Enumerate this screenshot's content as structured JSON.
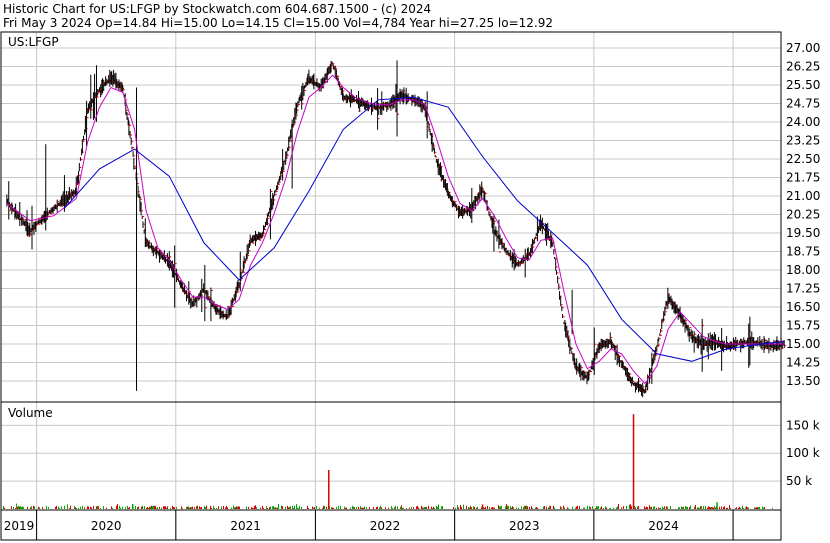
{
  "header": {
    "line1": "Historic Chart for US:LFGP by Stockwatch.com 604.687.1500 - (c) 2024",
    "line2": "Fri May  3 2024   Op=14.84  Hi=15.00  Lo=14.15  Cl=15.00  Vol=4,784  Year hi=27.25  lo=12.92"
  },
  "chart_data": [
    {
      "type": "line",
      "title": "US:LFGP",
      "yticks": [
        "27.00",
        "26.25",
        "25.50",
        "24.75",
        "24.00",
        "23.25",
        "22.50",
        "21.75",
        "21.00",
        "20.25",
        "19.50",
        "18.75",
        "18.00",
        "17.25",
        "16.50",
        "15.75",
        "15.00",
        "14.25",
        "13.50"
      ],
      "ylim": [
        12.92,
        27.5
      ],
      "x_range": [
        "2018-10-01",
        "2024-05-03"
      ],
      "x_year_labels": [
        "2019",
        "2020",
        "2021",
        "2022",
        "2023",
        "2024"
      ],
      "grid": true,
      "series": [
        {
          "color": "#000000",
          "x": [
            "2018-10",
            "2018-12",
            "2019-02",
            "2019-04",
            "2019-05",
            "2019-06",
            "2019-07",
            "2019-08",
            "2019-09",
            "2019-10",
            "2019-11",
            "2019-12",
            "2020-01",
            "2020-02",
            "2020-03",
            "2020-04",
            "2020-05",
            "2020-06",
            "2020-07",
            "2020-08",
            "2020-09",
            "2020-10",
            "2020-11",
            "2020-12",
            "2021-01",
            "2021-02",
            "2021-03",
            "2021-04",
            "2021-05",
            "2021-06",
            "2021-07",
            "2021-08",
            "2021-09",
            "2021-10",
            "2021-11",
            "2021-12",
            "2022-01",
            "2022-02",
            "2022-03",
            "2022-04",
            "2022-05",
            "2022-06",
            "2022-07",
            "2022-08",
            "2022-09",
            "2022-10",
            "2022-11",
            "2022-12",
            "2023-01",
            "2023-02",
            "2023-03",
            "2023-04",
            "2023-05",
            "2023-06",
            "2023-07",
            "2023-08",
            "2023-09",
            "2023-10",
            "2023-11",
            "2023-12",
            "2024-01",
            "2024-02",
            "2024-03",
            "2024-04",
            "2024-05"
          ],
          "values": [
            20.8,
            19.6,
            20.5,
            21.2,
            24.5,
            25.3,
            25.8,
            25.4,
            22.3,
            19.1,
            18.7,
            18.3,
            17.4,
            16.6,
            17.2,
            16.4,
            16.1,
            17.4,
            19.2,
            19.4,
            21.0,
            22.5,
            24.7,
            25.8,
            25.4,
            26.4,
            25.0,
            24.9,
            24.7,
            24.6,
            24.7,
            25.1,
            24.9,
            24.6,
            22.4,
            21.1,
            20.3,
            20.5,
            21.3,
            19.6,
            18.8,
            18.2,
            18.6,
            19.9,
            19.1,
            15.8,
            14.1,
            13.6,
            14.9,
            15.1,
            14.2,
            13.4,
            13.1,
            14.8,
            16.9,
            16.2,
            15.3,
            15.0,
            15.1,
            14.9,
            15.0,
            15.1,
            15.0,
            14.9,
            15.0
          ]
        },
        {
          "color": "#cc00cc",
          "x": [
            "2018-10",
            "2018-12",
            "2019-02",
            "2019-04",
            "2019-05",
            "2019-06",
            "2019-07",
            "2019-08",
            "2019-09",
            "2019-10",
            "2019-11",
            "2019-12",
            "2020-01",
            "2020-02",
            "2020-03",
            "2020-04",
            "2020-05",
            "2020-06",
            "2020-07",
            "2020-08",
            "2020-09",
            "2020-10",
            "2020-11",
            "2020-12",
            "2021-01",
            "2021-02",
            "2021-03",
            "2021-04",
            "2021-05",
            "2021-06",
            "2021-07",
            "2021-08",
            "2021-09",
            "2021-10",
            "2021-11",
            "2021-12",
            "2022-01",
            "2022-02",
            "2022-03",
            "2022-04",
            "2022-05",
            "2022-06",
            "2022-07",
            "2022-08",
            "2022-09",
            "2022-10",
            "2022-11",
            "2022-12",
            "2023-01",
            "2023-02",
            "2023-03",
            "2023-04",
            "2023-05",
            "2023-06",
            "2023-07",
            "2023-08",
            "2023-09",
            "2023-10",
            "2023-11",
            "2023-12",
            "2024-01",
            "2024-02",
            "2024-03",
            "2024-04",
            "2024-05"
          ],
          "values": [
            20.7,
            20.0,
            20.2,
            20.9,
            23.2,
            24.6,
            25.4,
            25.2,
            23.7,
            20.4,
            18.9,
            18.4,
            17.6,
            16.9,
            16.9,
            16.6,
            16.4,
            16.8,
            18.2,
            19.1,
            20.3,
            21.7,
            23.6,
            25.0,
            25.4,
            25.9,
            25.4,
            25.0,
            24.8,
            24.7,
            24.7,
            24.9,
            24.9,
            24.7,
            23.3,
            21.8,
            20.7,
            20.4,
            20.9,
            20.2,
            19.3,
            18.5,
            18.4,
            19.2,
            19.3,
            17.1,
            15.0,
            14.0,
            14.3,
            14.8,
            14.6,
            13.9,
            13.4,
            14.1,
            15.6,
            16.3,
            15.8,
            15.3,
            15.1,
            15.0,
            15.0,
            15.0,
            15.0,
            15.0,
            15.0
          ]
        },
        {
          "color": "#0000cc",
          "x": [
            "2019-03",
            "2019-06",
            "2019-09",
            "2019-12",
            "2020-03",
            "2020-06",
            "2020-09",
            "2020-12",
            "2021-03",
            "2021-06",
            "2021-09",
            "2021-12",
            "2022-03",
            "2022-06",
            "2022-09",
            "2022-12",
            "2023-03",
            "2023-06",
            "2023-09",
            "2023-12",
            "2024-03",
            "2024-05"
          ],
          "values": [
            20.5,
            22.1,
            22.9,
            21.8,
            19.1,
            17.6,
            18.9,
            21.2,
            23.7,
            24.9,
            25.0,
            24.6,
            22.6,
            20.8,
            19.5,
            18.2,
            16.0,
            14.6,
            14.3,
            14.8,
            15.0,
            15.1
          ]
        }
      ]
    },
    {
      "type": "bar",
      "title": "Volume",
      "yticks": [
        "150 k",
        "100 k",
        "50 k"
      ],
      "ylim": [
        0,
        190000
      ],
      "grid": true,
      "spikes": [
        {
          "x": "2021-02-05",
          "value": 70000,
          "color": "#dd0000"
        },
        {
          "x": "2023-04-15",
          "value": 170000,
          "color": "#dd0000"
        },
        {
          "x": "2019-09-10",
          "value": 9000,
          "color": "#00aa00"
        },
        {
          "x": "2022-03-15",
          "value": 8000,
          "color": "#dd0000"
        },
        {
          "x": "2023-11-20",
          "value": 12000,
          "color": "#00aa00"
        }
      ]
    }
  ]
}
